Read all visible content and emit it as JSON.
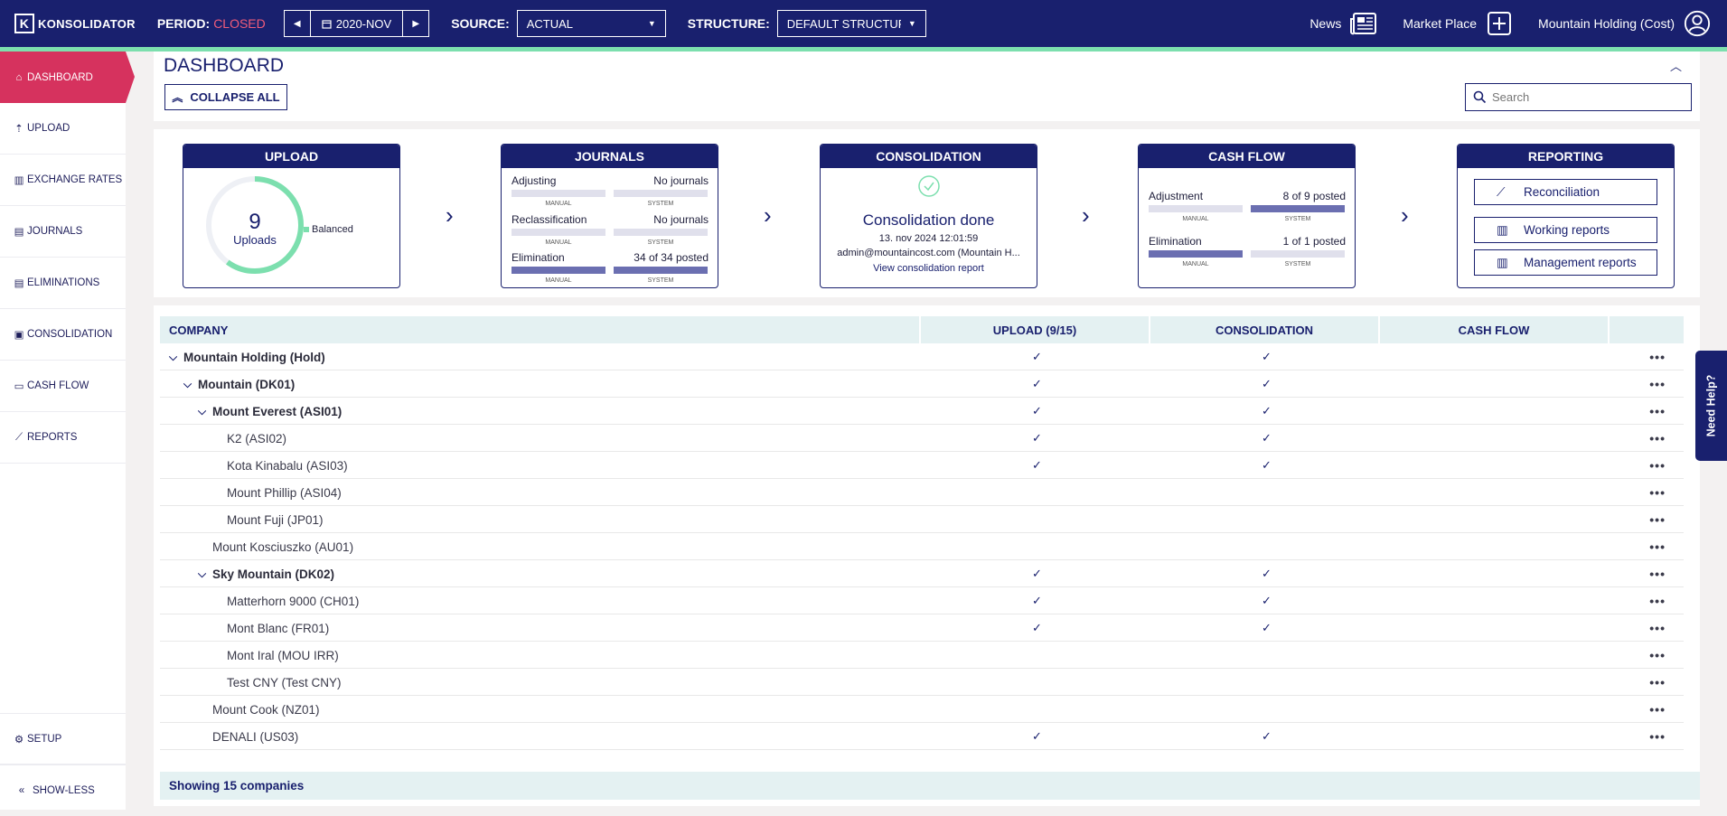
{
  "header": {
    "logo": "KONSOLIDATOR",
    "period_label": "PERIOD:",
    "period_status": "CLOSED",
    "period_value": "2020-NOV",
    "source_label": "SOURCE:",
    "source_value": "ACTUAL",
    "structure_label": "STRUCTURE:",
    "structure_value": "DEFAULT STRUCTURE",
    "news": "News",
    "market_place": "Market Place",
    "user": "Mountain Holding (Cost)"
  },
  "sidebar": {
    "items": [
      {
        "label": "DASHBOARD",
        "icon": "home-icon"
      },
      {
        "label": "UPLOAD",
        "icon": "upload-icon"
      },
      {
        "label": "EXCHANGE RATES",
        "icon": "exchange-icon"
      },
      {
        "label": "JOURNALS",
        "icon": "document-icon"
      },
      {
        "label": "ELIMINATIONS",
        "icon": "document-icon"
      },
      {
        "label": "CONSOLIDATION",
        "icon": "consolidation-icon"
      },
      {
        "label": "CASH FLOW",
        "icon": "cash-icon"
      },
      {
        "label": "REPORTS",
        "icon": "chart-icon"
      }
    ],
    "setup": "SETUP",
    "show_less": "SHOW-LESS"
  },
  "dashboard": {
    "title": "DASHBOARD",
    "collapse_all": "COLLAPSE ALL",
    "search_placeholder": "Search"
  },
  "upload_card": {
    "title": "UPLOAD",
    "count": "9",
    "count_label": "Uploads",
    "legend": "Balanced",
    "progress": 0.6
  },
  "journals_card": {
    "title": "JOURNALS",
    "rows": [
      {
        "label": "Adjusting",
        "status": "No journals",
        "manual": "MANUAL",
        "system": "SYSTEM"
      },
      {
        "label": "Reclassification",
        "status": "No journals",
        "manual": "MANUAL",
        "system": "SYSTEM"
      },
      {
        "label": "Elimination",
        "status": "34 of 34 posted",
        "manual": "MANUAL",
        "system": "SYSTEM"
      }
    ]
  },
  "consolidation_card": {
    "title": "CONSOLIDATION",
    "status": "Consolidation done",
    "timestamp": "13. nov 2024 12:01:59",
    "user": "admin@mountaincost.com (Mountain H...",
    "link": "View consolidation report"
  },
  "cashflow_card": {
    "title": "CASH FLOW",
    "rows": [
      {
        "label": "Adjustment",
        "status": "8 of 9 posted",
        "manual": "MANUAL",
        "system": "SYSTEM"
      },
      {
        "label": "Elimination",
        "status": "1 of 1 posted",
        "manual": "MANUAL",
        "system": "SYSTEM"
      }
    ]
  },
  "reporting_card": {
    "title": "REPORTING",
    "buttons": [
      "Reconciliation",
      "Working reports",
      "Management reports"
    ]
  },
  "table": {
    "columns": [
      "COMPANY",
      "UPLOAD (9/15)",
      "CONSOLIDATION",
      "CASH FLOW"
    ],
    "rows": [
      {
        "name": "Mountain Holding (Hold)",
        "level": 0,
        "bold": true,
        "expand": true,
        "upload": true,
        "consolidation": true
      },
      {
        "name": "Mountain (DK01)",
        "level": 1,
        "bold": true,
        "expand": true,
        "upload": true,
        "consolidation": true
      },
      {
        "name": "Mount Everest (ASI01)",
        "level": 2,
        "bold": true,
        "expand": true,
        "upload": true,
        "consolidation": true
      },
      {
        "name": "K2 (ASI02)",
        "level": 3,
        "bold": false,
        "expand": false,
        "upload": true,
        "consolidation": true
      },
      {
        "name": "Kota Kinabalu (ASI03)",
        "level": 3,
        "bold": false,
        "expand": false,
        "upload": true,
        "consolidation": true
      },
      {
        "name": "Mount Phillip (ASI04)",
        "level": 3,
        "bold": false,
        "expand": false,
        "upload": false,
        "consolidation": false
      },
      {
        "name": "Mount Fuji (JP01)",
        "level": 3,
        "bold": false,
        "expand": false,
        "upload": false,
        "consolidation": false
      },
      {
        "name": "Mount Kosciuszko (AU01)",
        "level": 2,
        "bold": false,
        "expand": false,
        "upload": false,
        "consolidation": false
      },
      {
        "name": "Sky Mountain (DK02)",
        "level": 2,
        "bold": true,
        "expand": true,
        "upload": true,
        "consolidation": true
      },
      {
        "name": "Matterhorn 9000 (CH01)",
        "level": 3,
        "bold": false,
        "expand": false,
        "upload": true,
        "consolidation": true
      },
      {
        "name": "Mont Blanc (FR01)",
        "level": 3,
        "bold": false,
        "expand": false,
        "upload": true,
        "consolidation": true
      },
      {
        "name": "Mont Iral (MOU IRR)",
        "level": 3,
        "bold": false,
        "expand": false,
        "upload": false,
        "consolidation": false
      },
      {
        "name": "Test CNY (Test CNY)",
        "level": 3,
        "bold": false,
        "expand": false,
        "upload": false,
        "consolidation": false
      },
      {
        "name": "Mount Cook (NZ01)",
        "level": 2,
        "bold": false,
        "expand": false,
        "upload": false,
        "consolidation": false
      },
      {
        "name": "DENALI (US03)",
        "level": 2,
        "bold": false,
        "expand": false,
        "upload": true,
        "consolidation": true
      }
    ],
    "footer": "Showing 15 companies"
  },
  "help": "Need Help?",
  "colors": {
    "navy": "#19206e",
    "accent": "#d6325e",
    "green": "#7cdfae",
    "closed": "#f05c7a"
  }
}
